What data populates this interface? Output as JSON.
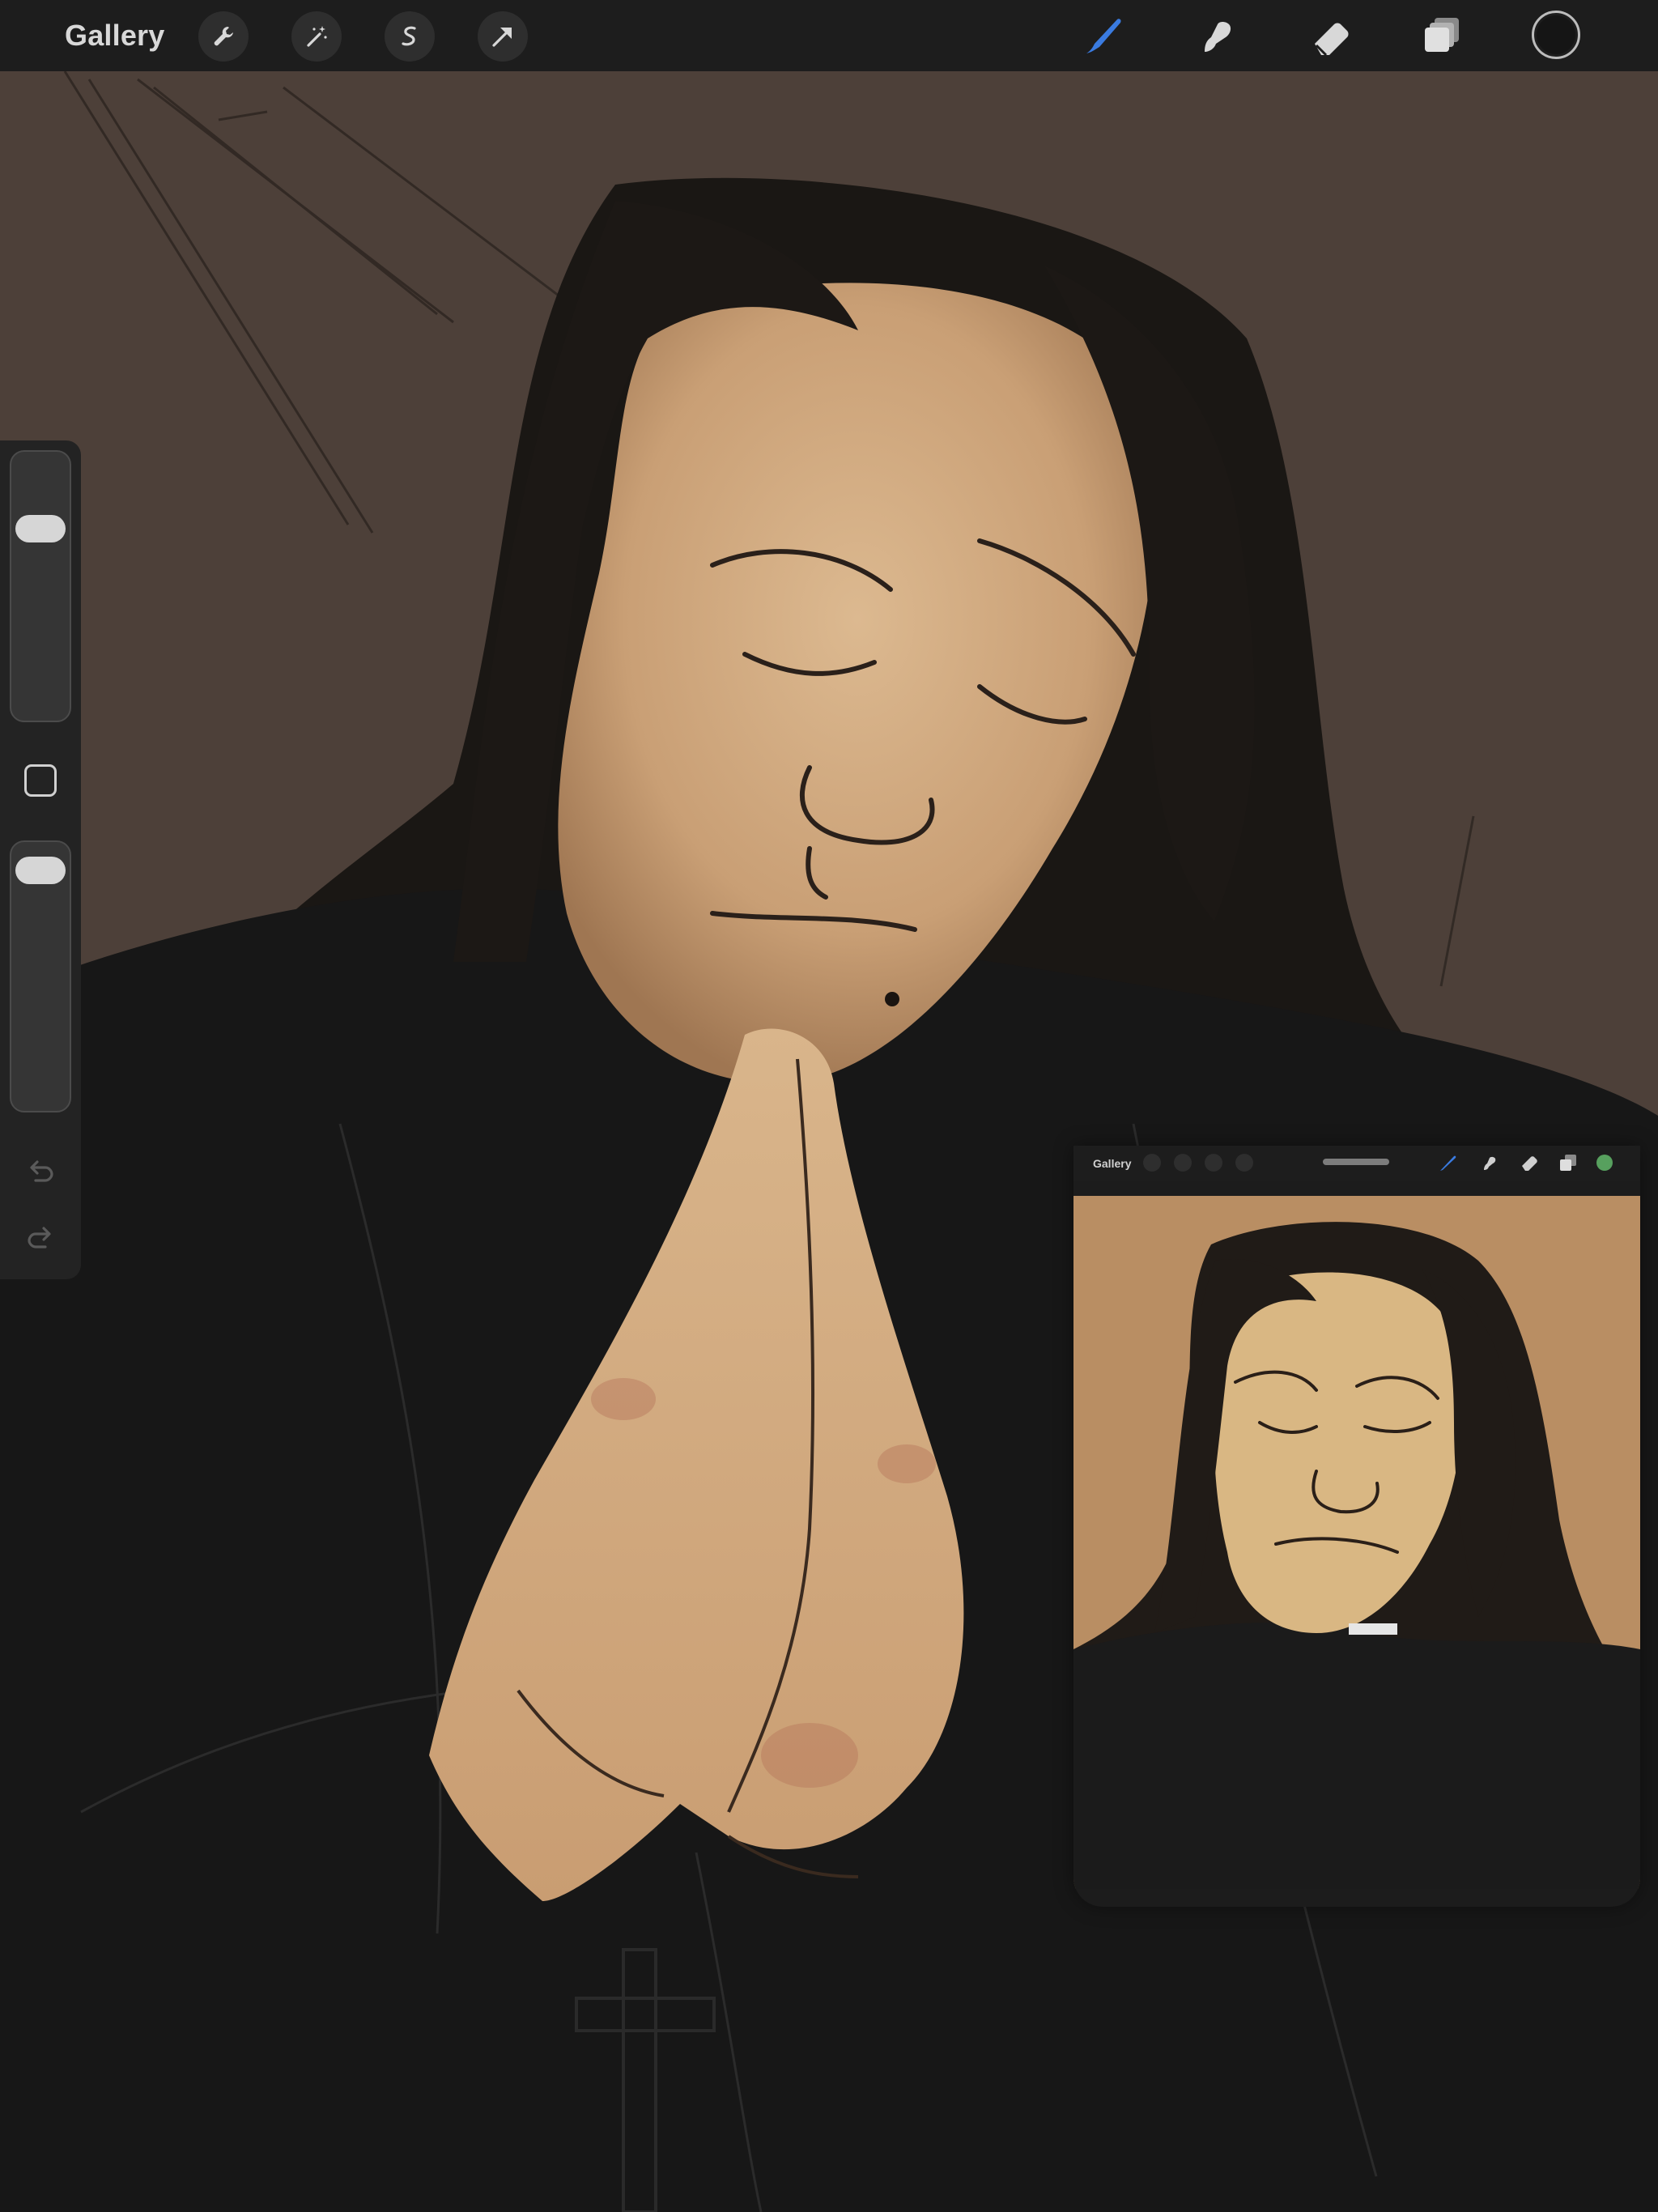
{
  "topbar": {
    "gallery_label": "Gallery",
    "left_tools": [
      {
        "name": "actions",
        "icon": "wrench-icon"
      },
      {
        "name": "adjustments",
        "icon": "magic-wand-icon"
      },
      {
        "name": "selection",
        "icon": "selection-s-icon"
      },
      {
        "name": "transform",
        "icon": "arrow-cursor-icon"
      }
    ],
    "right_tools": [
      {
        "name": "brush",
        "icon": "brush-icon",
        "active": true
      },
      {
        "name": "smudge",
        "icon": "smudge-icon",
        "active": false
      },
      {
        "name": "eraser",
        "icon": "eraser-icon",
        "active": false
      },
      {
        "name": "layers",
        "icon": "layers-icon",
        "active": false
      }
    ],
    "current_color": "#151515",
    "active_tool_color": "#3a7be0"
  },
  "sidebar": {
    "brush_size_level": 0.1,
    "brush_opacity_level": 0.05,
    "modify_button": "square-icon",
    "undo_icon": "undo-icon",
    "redo_icon": "redo-icon"
  },
  "reference_window": {
    "gallery_label": "Gallery",
    "current_color": "#57a05e"
  },
  "canvas": {
    "background_color": "#4d4039",
    "robe_color": "#171717",
    "skin_color": "#d4a87c",
    "reference_background": "#b98e63"
  }
}
